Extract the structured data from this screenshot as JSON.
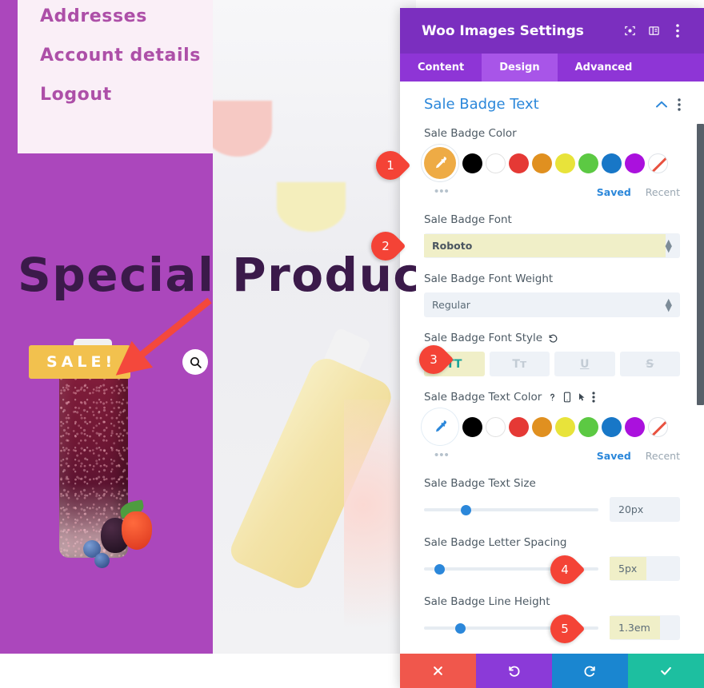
{
  "preview": {
    "account_links": [
      "Addresses",
      "Account details",
      "Logout"
    ],
    "headline": "Special Product",
    "sale_badge_text": "SALE!",
    "search_icon": "search-icon",
    "colors": {
      "page_purple": "#ab47bc",
      "account_panel_bg": "#faeff7",
      "account_link_color": "#ad4fa8",
      "headline_color": "#3b1a4a",
      "sale_badge_bg": "#f2c14e",
      "sale_badge_text_color": "#ffffff"
    }
  },
  "panel": {
    "title": "Woo Images Settings",
    "header_icons": [
      "fullscreen-icon",
      "split-view-icon",
      "more-vertical-icon"
    ],
    "tabs": [
      {
        "label": "Content",
        "active": false
      },
      {
        "label": "Design",
        "active": true
      },
      {
        "label": "Advanced",
        "active": false
      }
    ],
    "section": {
      "title": "Sale Badge Text",
      "collapse_icon": "chevron-up-icon",
      "more_icon": "more-vertical-icon"
    },
    "fields": {
      "badge_color": {
        "label": "Sale Badge Color",
        "eyedropper": "eyedropper-icon",
        "eyedropper_selected": true,
        "swatches": [
          "#000000",
          "#ffffff",
          "#e53935",
          "#e09020",
          "#e8e33a",
          "#5cc943",
          "#1877c7",
          "#aa11dd",
          "transparent"
        ],
        "more_label": "•••",
        "saved_label": "Saved",
        "recent_label": "Recent"
      },
      "badge_font": {
        "label": "Sale Badge Font",
        "value": "Roboto",
        "highlighted": true
      },
      "badge_font_weight": {
        "label": "Sale Badge Font Weight",
        "value": "Regular",
        "highlighted": false
      },
      "badge_font_style": {
        "label": "Sale Badge Font Style",
        "reset_icon": "reset-icon",
        "buttons": [
          {
            "glyph": "TT",
            "name": "uppercase",
            "active": true
          },
          {
            "glyph": "Tт",
            "name": "smallcaps",
            "active": false
          },
          {
            "glyph": "U",
            "name": "underline",
            "active": false
          },
          {
            "glyph": "S",
            "name": "strikethrough",
            "active": false
          }
        ]
      },
      "badge_text_color": {
        "label": "Sale Badge Text Color",
        "label_icons": [
          "help-icon",
          "mobile-icon",
          "cursor-icon",
          "more-vertical-icon"
        ],
        "eyedropper": "eyedropper-icon",
        "eyedropper_selected": false,
        "swatches": [
          "#000000",
          "#ffffff",
          "#e53935",
          "#e09020",
          "#e8e33a",
          "#5cc943",
          "#1877c7",
          "#aa11dd",
          "transparent"
        ],
        "more_label": "•••",
        "saved_label": "Saved",
        "recent_label": "Recent"
      },
      "badge_text_size": {
        "label": "Sale Badge Text Size",
        "value": "20px",
        "slider_percent": 21,
        "highlighted": false
      },
      "badge_letter_spacing": {
        "label": "Sale Badge Letter Spacing",
        "value": "5px",
        "slider_percent": 6,
        "highlighted": true
      },
      "badge_line_height": {
        "label": "Sale Badge Line Height",
        "value": "1.3em",
        "slider_percent": 18,
        "highlighted": true
      }
    },
    "actions": [
      {
        "name": "cancel",
        "icon": "close-icon",
        "color": "#f0574c"
      },
      {
        "name": "undo",
        "icon": "undo-icon",
        "color": "#8b3ad8"
      },
      {
        "name": "redo",
        "icon": "redo-icon",
        "color": "#1a86d0"
      },
      {
        "name": "save",
        "icon": "check-icon",
        "color": "#1dbfa0"
      }
    ]
  },
  "callouts": [
    {
      "number": "1",
      "target": "badge-color-eyedropper"
    },
    {
      "number": "2",
      "target": "badge-font-select"
    },
    {
      "number": "3",
      "target": "font-style-uppercase"
    },
    {
      "number": "4",
      "target": "letter-spacing-value"
    },
    {
      "number": "5",
      "target": "line-height-value"
    }
  ]
}
